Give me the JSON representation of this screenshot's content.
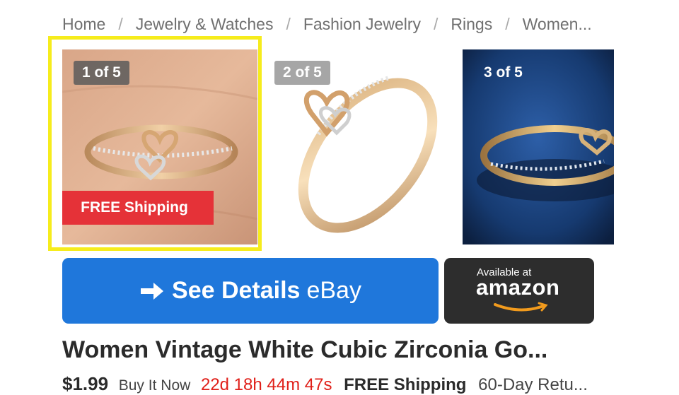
{
  "breadcrumb": [
    "Home",
    "Jewelry & Watches",
    "Fashion Jewelry",
    "Rings",
    "Women..."
  ],
  "gallery": {
    "badges": [
      "1 of 5",
      "2 of 5",
      "3 of 5"
    ],
    "free_shipping": "FREE Shipping"
  },
  "buttons": {
    "ebay_bold": "See Details",
    "ebay_brand": "eBay",
    "amazon_available": "Available at",
    "amazon_logo": "amazon"
  },
  "product": {
    "title": "Women Vintage White Cubic Zirconia Go...",
    "price": "$1.99",
    "buy_type": "Buy It Now",
    "countdown": "22d 18h 44m 47s",
    "shipping": "FREE Shipping",
    "returns": "60-Day Retu..."
  },
  "colors": {
    "ebay_button": "#1f77db",
    "amazon_button": "#2d2d2d",
    "free_ship_banner": "#e53238",
    "highlight": "#f6ec1c"
  }
}
